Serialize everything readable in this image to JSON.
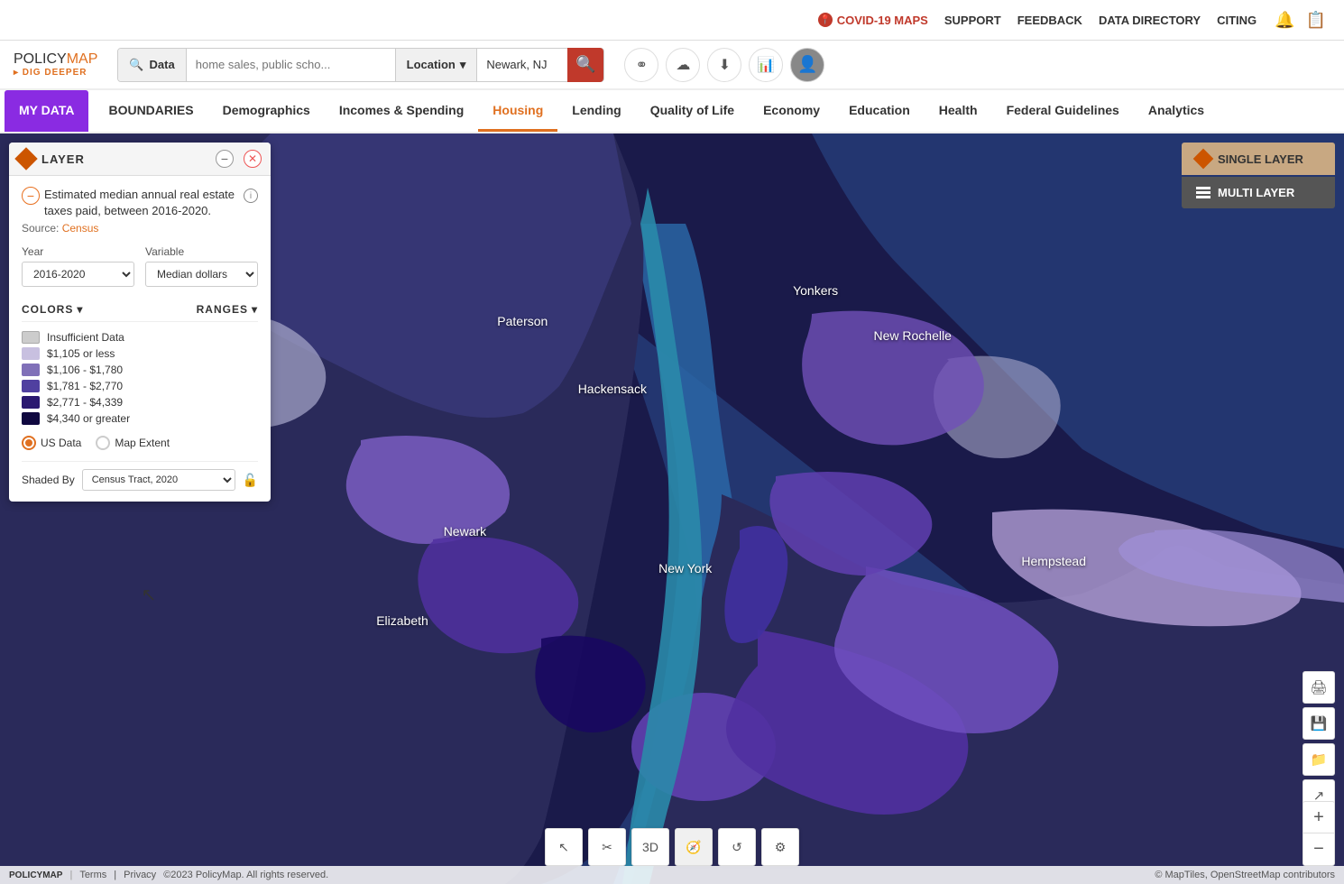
{
  "topbar": {
    "covid_label": "COVID-19 MAPS",
    "support_label": "SUPPORT",
    "feedback_label": "FEEDBACK",
    "data_directory_label": "DATA DIRECTORY",
    "citing_label": "CITING"
  },
  "header": {
    "logo_policy": "POLICY",
    "logo_map": "MAP",
    "logo_sub": "▸ DIG DEEPER",
    "search_tab_data": "Data",
    "search_placeholder": "home sales, public scho...",
    "location_tab": "Location",
    "location_value": "Newark, NJ",
    "search_aria": "Search"
  },
  "nav": {
    "my_data": "MY DATA",
    "boundaries": "BOUNDARIES",
    "demographics": "Demographics",
    "incomes": "Incomes & Spending",
    "housing": "Housing",
    "lending": "Lending",
    "quality_of_life": "Quality of Life",
    "economy": "Economy",
    "education": "Education",
    "health": "Health",
    "federal_guidelines": "Federal Guidelines",
    "analytics": "Analytics"
  },
  "layer_panel": {
    "title": "LAYER",
    "description": "Estimated median annual real estate taxes paid, between 2016-2020.",
    "source_prefix": "Source:",
    "source_link": "Census",
    "year_label": "Year",
    "year_value": "2016-2020",
    "variable_label": "Variable",
    "variable_value": "Median dollars",
    "colors_label": "COLORS",
    "ranges_label": "RANGES",
    "legend": [
      {
        "color": "#ccc",
        "label": "Insufficient Data"
      },
      {
        "color": "#c8c0e0",
        "label": "$1,105 or less"
      },
      {
        "color": "#9080c0",
        "label": "$1,106 - $1,780"
      },
      {
        "color": "#5040a0",
        "label": "$1,781 - $2,770"
      },
      {
        "color": "#2820780",
        "label": "$2,771 - $4,339"
      },
      {
        "color": "#100840",
        "label": "$4,340 or greater"
      }
    ],
    "radio_us_data": "US Data",
    "radio_map_extent": "Map Extent",
    "shaded_by_label": "Shaded By",
    "shaded_by_value": "Census Tract, 2020"
  },
  "layer_mode": {
    "single_label": "SINGLE LAYER",
    "multi_label": "MULTI LAYER"
  },
  "map_controls": {
    "zoom_in": "+",
    "zoom_out": "−"
  },
  "map_labels": [
    {
      "text": "Paterson",
      "top": "25%",
      "left": "37%"
    },
    {
      "text": "Hackensack",
      "top": "34%",
      "left": "43%"
    },
    {
      "text": "Yonkers",
      "top": "22%",
      "left": "60%"
    },
    {
      "text": "New Rochelle",
      "top": "26%",
      "left": "68%"
    },
    {
      "text": "Newark",
      "top": "52%",
      "left": "36%"
    },
    {
      "text": "New York",
      "top": "57%",
      "left": "50%"
    },
    {
      "text": "Elizabeth",
      "top": "64%",
      "left": "31%"
    },
    {
      "text": "Hempstead",
      "top": "56%",
      "left": "78%"
    }
  ],
  "footer": {
    "logo": "POLICYMAP",
    "terms": "Terms",
    "privacy": "Privacy",
    "copyright": "©2023 PolicyMap. All rights reserved.",
    "maptiles": "© MapTiles, OpenStreetMap contributors"
  }
}
